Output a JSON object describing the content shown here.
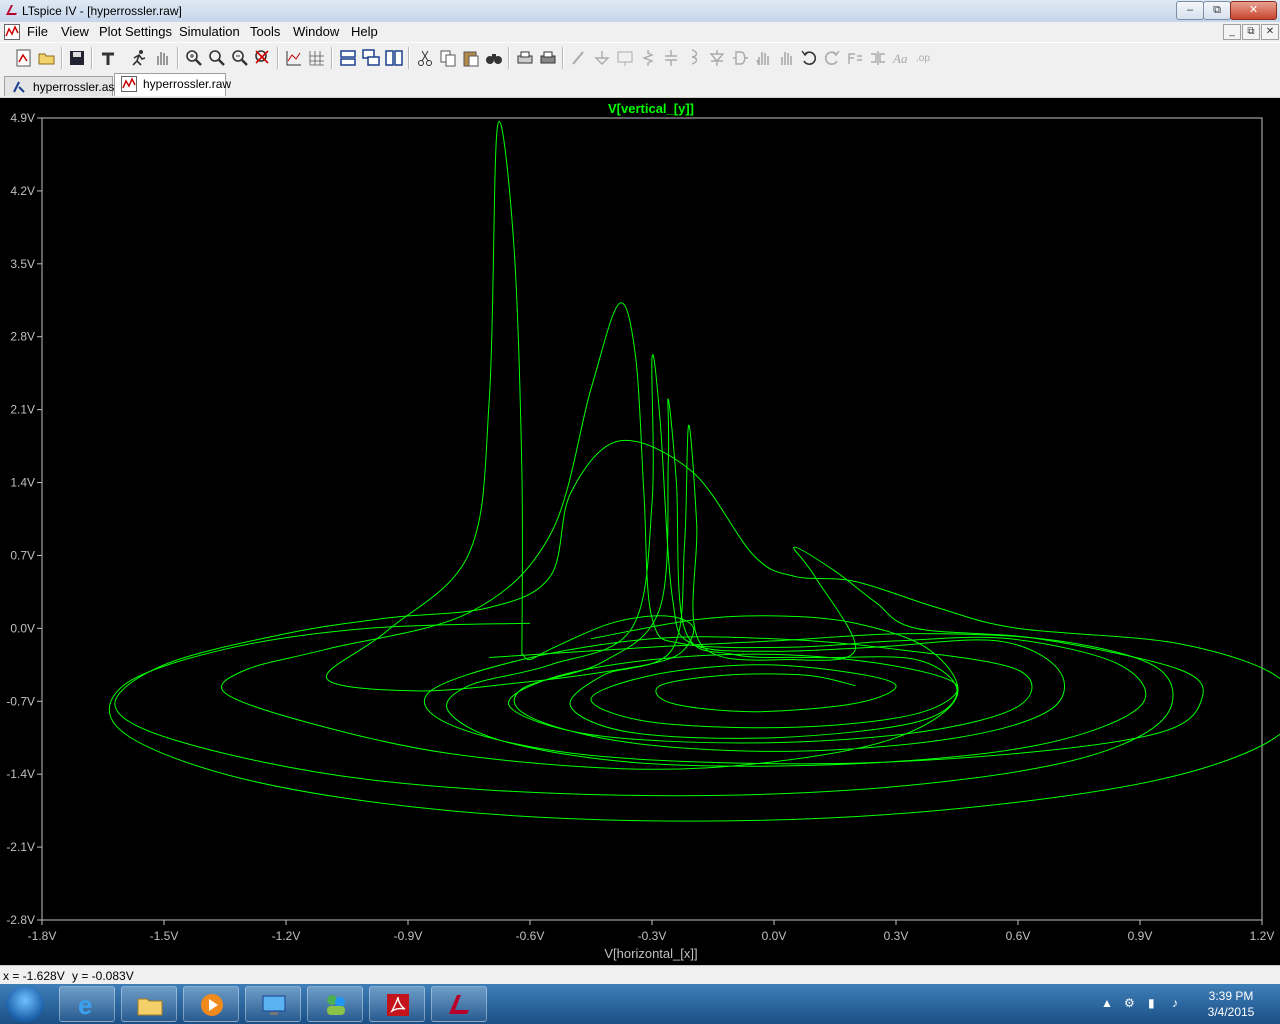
{
  "window": {
    "title": "LTspice IV - [hyperrossler.raw]",
    "minimize": "–",
    "restore": "⧉",
    "close": "✕"
  },
  "menu": {
    "items": [
      "File",
      "View",
      "Plot Settings",
      "Simulation",
      "Tools",
      "Window",
      "Help"
    ],
    "mdi_min": "_",
    "mdi_restore": "⧉",
    "mdi_close": "✕"
  },
  "toolbar": {
    "icons": [
      "new-schematic-icon",
      "open-icon",
      "save-icon",
      "control-panel-icon",
      "run-icon",
      "halt-icon",
      "zoom-area-icon",
      "zoom-in-icon",
      "zoom-out-icon",
      "zoom-cancel-icon",
      "autorange-icon",
      "grid-icon",
      "tile-horizontal-icon",
      "cascade-icon",
      "tile-vertical-icon",
      "cut-icon",
      "copy-icon",
      "paste-icon",
      "find-icon",
      "print-preview-icon",
      "print-icon",
      "wire-icon",
      "ground-icon",
      "label-icon",
      "resistor-icon",
      "capacitor-icon",
      "inductor-icon",
      "diode-icon",
      "component-icon",
      "move-icon",
      "drag-icon",
      "undo-icon",
      "redo-icon",
      "rotate-icon",
      "mirror-icon",
      "text-icon",
      "spice-directive-icon"
    ]
  },
  "tabs": [
    {
      "label": "hyperrossler.asc",
      "icon": "schematic-icon",
      "active": false
    },
    {
      "label": "hyperrossler.raw",
      "icon": "waveform-icon",
      "active": true
    }
  ],
  "status": {
    "x": "x = -1.628V",
    "y": "y = -0.083V"
  },
  "taskbar": {
    "time": "3:39 PM",
    "date": "3/4/2015",
    "apps": [
      "internet-explorer-icon",
      "file-explorer-icon",
      "media-player-icon",
      "remote-desktop-icon",
      "messenger-icon",
      "acrobat-icon",
      "ltspice-icon"
    ]
  },
  "chart_data": {
    "type": "line",
    "title": "V[vertical_[y]]",
    "xlabel": "V[horizontal_[x]]",
    "ylabel": "",
    "xlim": [
      -1.8,
      1.2
    ],
    "ylim": [
      -2.8,
      4.9
    ],
    "x_ticks": [
      "-1.8V",
      "-1.5V",
      "-1.2V",
      "-0.9V",
      "-0.6V",
      "-0.3V",
      "0.0V",
      "0.3V",
      "0.6V",
      "0.9V",
      "1.2V"
    ],
    "y_ticks": [
      "4.9V",
      "4.2V",
      "3.5V",
      "2.8V",
      "2.1V",
      "1.4V",
      "0.7V",
      "0.0V",
      "-0.7V",
      "-1.4V",
      "-2.1V",
      "-2.8V"
    ],
    "grid": false,
    "color": "#00ff00",
    "background": "#000000",
    "series": [
      {
        "values": [
          [
            -0.62,
            -0.24
          ],
          [
            -0.6,
            -0.3
          ],
          [
            -0.55,
            -0.2
          ],
          [
            -0.4,
            0.05
          ],
          [
            -0.27,
            0.12
          ],
          [
            -0.2,
            0.02
          ],
          [
            -0.22,
            -0.2
          ],
          [
            -0.28,
            -0.32
          ],
          [
            -0.42,
            -0.42
          ],
          [
            -0.62,
            -0.52
          ],
          [
            -0.88,
            -0.6
          ],
          [
            -1.1,
            -0.48
          ],
          [
            -0.95,
            -0.02
          ],
          [
            -0.75,
            0.72
          ],
          [
            -0.7,
            2.2
          ],
          [
            -0.68,
            4.82
          ],
          [
            -0.64,
            3.7
          ],
          [
            -0.62,
            1.5
          ],
          [
            -0.62,
            -0.25
          ]
        ]
      },
      {
        "values": [
          [
            -0.45,
            -0.1
          ],
          [
            -0.2,
            0.08
          ],
          [
            0.0,
            0.12
          ],
          [
            0.2,
            0.05
          ],
          [
            0.38,
            -0.2
          ],
          [
            0.45,
            -0.65
          ],
          [
            0.3,
            -1.05
          ],
          [
            0.0,
            -1.28
          ],
          [
            -0.35,
            -1.35
          ],
          [
            -0.8,
            -1.2
          ],
          [
            -1.15,
            -0.9
          ],
          [
            -1.35,
            -0.62
          ],
          [
            -1.3,
            -0.4
          ],
          [
            -1.1,
            -0.2
          ],
          [
            -0.75,
            0.15
          ],
          [
            -0.55,
            0.9
          ],
          [
            -0.45,
            2.3
          ],
          [
            -0.38,
            3.12
          ],
          [
            -0.34,
            2.6
          ],
          [
            -0.32,
            1.3
          ],
          [
            -0.3,
            0.1
          ],
          [
            -0.22,
            -0.15
          ],
          [
            0.05,
            -0.18
          ],
          [
            0.3,
            -0.12
          ],
          [
            0.58,
            -0.1
          ],
          [
            0.85,
            -0.35
          ],
          [
            0.9,
            -0.75
          ],
          [
            0.65,
            -1.12
          ],
          [
            0.2,
            -1.3
          ],
          [
            -0.3,
            -1.3
          ],
          [
            -0.65,
            -1.1
          ],
          [
            -0.8,
            -0.8
          ],
          [
            -0.75,
            -0.55
          ],
          [
            -0.55,
            -0.35
          ],
          [
            -0.35,
            0.0
          ],
          [
            -0.3,
            1.2
          ],
          [
            -0.3,
            2.6
          ],
          [
            -0.28,
            2.0
          ],
          [
            -0.25,
            0.3
          ],
          [
            -0.2,
            -0.15
          ],
          [
            0.0,
            -0.22
          ],
          [
            0.25,
            -0.18
          ],
          [
            0.55,
            -0.12
          ],
          [
            0.7,
            -0.4
          ],
          [
            0.68,
            -0.78
          ],
          [
            0.45,
            -1.05
          ],
          [
            0.05,
            -1.18
          ],
          [
            -0.35,
            -1.1
          ],
          [
            -0.6,
            -0.85
          ],
          [
            -0.62,
            -0.58
          ],
          [
            -0.42,
            -0.32
          ],
          [
            -0.28,
            0.2
          ],
          [
            -0.26,
            1.6
          ],
          [
            -0.26,
            2.2
          ],
          [
            -0.24,
            1.4
          ],
          [
            -0.22,
            0.0
          ],
          [
            -0.1,
            -0.25
          ],
          [
            0.1,
            -0.28
          ],
          [
            0.35,
            -0.3
          ],
          [
            0.45,
            -0.6
          ],
          [
            0.35,
            -0.9
          ],
          [
            0.0,
            -1.05
          ],
          [
            -0.35,
            -1.0
          ],
          [
            -0.5,
            -0.75
          ],
          [
            -0.42,
            -0.45
          ],
          [
            -0.25,
            -0.2
          ],
          [
            -0.22,
            0.8
          ],
          [
            -0.21,
            1.95
          ],
          [
            -0.19,
            1.0
          ],
          [
            -0.18,
            -0.15
          ],
          [
            0.05,
            -0.3
          ],
          [
            0.2,
            -0.2
          ],
          [
            0.1,
            0.5
          ],
          [
            0.05,
            0.78
          ],
          [
            0.15,
            0.55
          ],
          [
            0.25,
            0.25
          ],
          [
            0.35,
            0.0
          ],
          [
            0.65,
            -0.1
          ],
          [
            1.0,
            -0.4
          ],
          [
            1.05,
            -0.7
          ],
          [
            0.95,
            -1.0
          ],
          [
            0.6,
            -1.2
          ],
          [
            0.1,
            -1.3
          ],
          [
            -0.45,
            -1.22
          ],
          [
            -0.78,
            -0.95
          ],
          [
            -0.85,
            -0.62
          ],
          [
            -0.62,
            -0.3
          ],
          [
            -0.3,
            -0.1
          ],
          [
            0.0,
            -0.1
          ],
          [
            0.3,
            -0.2
          ],
          [
            0.6,
            -0.4
          ],
          [
            0.6,
            -0.75
          ],
          [
            0.35,
            -1.0
          ],
          [
            -0.05,
            -1.1
          ],
          [
            -0.45,
            -1.02
          ],
          [
            -0.65,
            -0.75
          ],
          [
            -0.55,
            -0.48
          ],
          [
            -0.3,
            -0.3
          ],
          [
            0.0,
            -0.25
          ],
          [
            0.28,
            -0.35
          ],
          [
            0.45,
            -0.55
          ],
          [
            0.35,
            -0.82
          ],
          [
            0.05,
            -0.95
          ],
          [
            -0.3,
            -0.9
          ],
          [
            -0.45,
            -0.68
          ],
          [
            -0.3,
            -0.45
          ],
          [
            -0.05,
            -0.35
          ],
          [
            0.18,
            -0.42
          ],
          [
            0.3,
            -0.55
          ],
          [
            0.2,
            -0.72
          ],
          [
            -0.05,
            -0.8
          ],
          [
            -0.25,
            -0.72
          ],
          [
            -0.28,
            -0.55
          ],
          [
            -0.12,
            -0.45
          ],
          [
            0.08,
            -0.45
          ],
          [
            0.2,
            -0.55
          ]
        ]
      },
      {
        "values": [
          [
            -0.7,
            -0.28
          ],
          [
            -0.3,
            -0.18
          ],
          [
            0.0,
            -0.12
          ],
          [
            0.35,
            -0.05
          ],
          [
            0.7,
            -0.12
          ],
          [
            0.95,
            -0.4
          ],
          [
            0.95,
            -0.9
          ],
          [
            0.7,
            -1.3
          ],
          [
            0.2,
            -1.55
          ],
          [
            -0.4,
            -1.6
          ],
          [
            -1.0,
            -1.45
          ],
          [
            -1.45,
            -1.1
          ],
          [
            -1.62,
            -0.75
          ],
          [
            -1.5,
            -0.35
          ],
          [
            -1.2,
            -0.05
          ],
          [
            -0.95,
            0.1
          ],
          [
            -0.7,
            0.2
          ],
          [
            -0.55,
            0.5
          ],
          [
            -0.5,
            1.3
          ],
          [
            -0.38,
            1.8
          ],
          [
            -0.2,
            1.5
          ],
          [
            -0.05,
            0.7
          ],
          [
            0.05,
            0.5
          ],
          [
            0.2,
            0.45
          ],
          [
            0.4,
            0.2
          ],
          [
            0.6,
            0.0
          ],
          [
            1.0,
            -0.15
          ],
          [
            1.25,
            -0.5
          ],
          [
            1.25,
            -1.0
          ],
          [
            0.95,
            -1.45
          ],
          [
            0.4,
            -1.75
          ],
          [
            -0.2,
            -1.85
          ],
          [
            -0.8,
            -1.75
          ],
          [
            -1.3,
            -1.45
          ],
          [
            -1.6,
            -1.0
          ],
          [
            -1.6,
            -0.55
          ],
          [
            -1.35,
            -0.2
          ],
          [
            -1.0,
            0.0
          ],
          [
            -0.6,
            0.05
          ]
        ]
      }
    ]
  }
}
